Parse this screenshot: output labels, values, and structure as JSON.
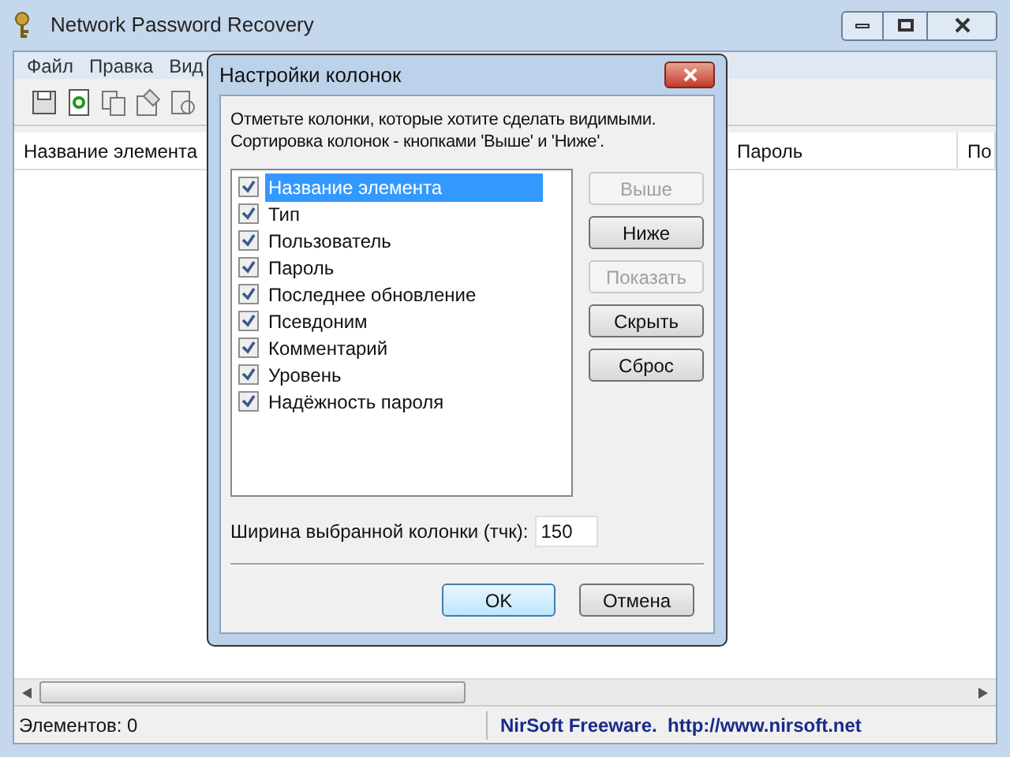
{
  "window": {
    "title": "Network Password Recovery"
  },
  "menu": [
    "Файл",
    "Правка",
    "Вид"
  ],
  "table": {
    "columns": [
      "Название элемента",
      "Пароль",
      "По"
    ]
  },
  "status_bar": {
    "count": "Элементов: 0",
    "credit": "NirSoft Freeware.  http://www.nirsoft.net"
  },
  "dialog": {
    "title": "Настройки колонок",
    "description": "Отметьте колонки, которые хотите сделать видимыми.\nСортировка колонок - кнопками 'Выше' и 'Ниже'.",
    "items": [
      {
        "label": "Название элемента",
        "checked": true,
        "selected": true
      },
      {
        "label": "Тип",
        "checked": true,
        "selected": false
      },
      {
        "label": "Пользователь",
        "checked": true,
        "selected": false
      },
      {
        "label": "Пароль",
        "checked": true,
        "selected": false
      },
      {
        "label": "Последнее обновление",
        "checked": true,
        "selected": false
      },
      {
        "label": "Псевдоним",
        "checked": true,
        "selected": false
      },
      {
        "label": "Комментарий",
        "checked": true,
        "selected": false
      },
      {
        "label": "Уровень",
        "checked": true,
        "selected": false
      },
      {
        "label": "Надёжность пароля",
        "checked": true,
        "selected": false
      }
    ],
    "side_buttons": [
      {
        "label": "Выше",
        "disabled": true
      },
      {
        "label": "Ниже",
        "disabled": false
      },
      {
        "label": "Показать",
        "disabled": true
      },
      {
        "label": "Скрыть",
        "disabled": false
      },
      {
        "label": "Сброс",
        "disabled": false
      }
    ],
    "width_label": "Ширина выбранной колонки (тчк):",
    "width_value": "150",
    "ok": "OK",
    "cancel": "Отмена"
  }
}
